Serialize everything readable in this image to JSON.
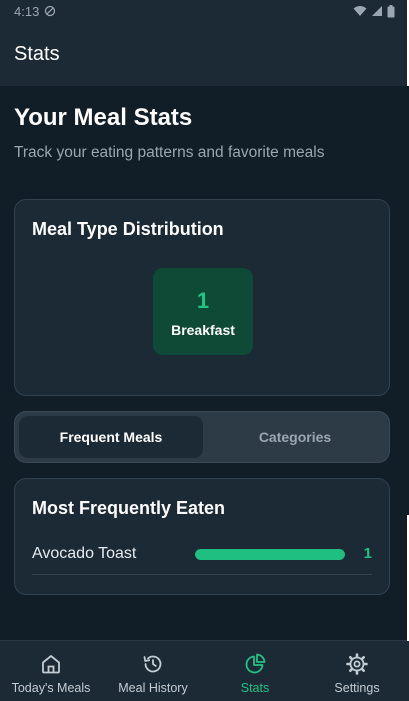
{
  "status_bar": {
    "time": "4:13"
  },
  "app_bar": {
    "title": "Stats"
  },
  "page": {
    "title": "Your Meal Stats",
    "subtitle": "Track your eating patterns and favorite meals"
  },
  "distribution": {
    "title": "Meal Type Distribution",
    "items": [
      {
        "count": "1",
        "label": "Breakfast"
      }
    ]
  },
  "tabs": [
    {
      "label": "Frequent Meals",
      "active": true
    },
    {
      "label": "Categories",
      "active": false
    }
  ],
  "frequent": {
    "title": "Most Frequently Eaten",
    "meals": [
      {
        "name": "Avocado Toast",
        "count": "1",
        "fill_fraction": 1.0
      }
    ]
  },
  "bottom_nav": [
    {
      "label": "Today's Meals",
      "icon": "home-icon",
      "active": false
    },
    {
      "label": "Meal History",
      "icon": "history-icon",
      "active": false
    },
    {
      "label": "Stats",
      "icon": "pie-chart-icon",
      "active": true
    },
    {
      "label": "Settings",
      "icon": "gear-icon",
      "active": false
    }
  ],
  "colors": {
    "accent": "#22c285",
    "background": "#111d27",
    "surface": "#1c2a36",
    "muted_text": "#9aa6b0"
  }
}
